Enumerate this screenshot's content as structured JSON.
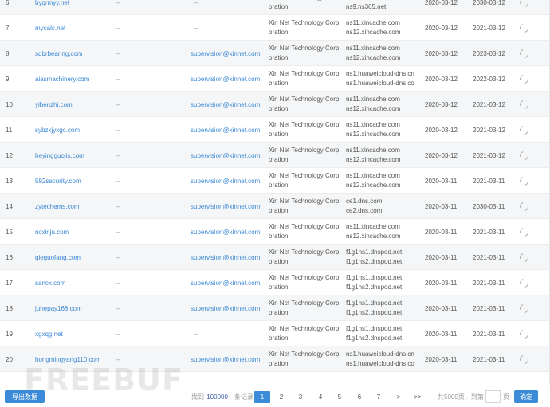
{
  "colors": {
    "accent": "#3b8bd8",
    "link": "#3a88d6",
    "row_stripe": "#f5f6f7"
  },
  "rows": [
    {
      "idx": "6",
      "domain": "byqrmyy.net",
      "d1": "--",
      "email": "--",
      "reg1": "Xin Net Technology Corp",
      "reg2": "oration",
      "ns1": "ns10.ns365.net",
      "ns2": "ns9.ns365.net",
      "date1": "2020-03-12",
      "date2": "2030-03-12"
    },
    {
      "idx": "7",
      "domain": "mycalc.net",
      "d1": "--",
      "email": "--",
      "reg1": "Xin Net Technology Corp",
      "reg2": "oration",
      "ns1": "ns11.xincache.com",
      "ns2": "ns12.xincache.com",
      "date1": "2020-03-12",
      "date2": "2021-03-12"
    },
    {
      "idx": "8",
      "domain": "sdbrbearing.com",
      "d1": "--",
      "email": "supervision@xinnet.com",
      "reg1": "Xin Net Technology Corp",
      "reg2": "oration",
      "ns1": "ns11.xincache.com",
      "ns2": "ns12.xincache.com",
      "date1": "2020-03-12",
      "date2": "2023-03-12"
    },
    {
      "idx": "9",
      "domain": "aiasmachinery.com",
      "d1": "--",
      "email": "supervision@xinnet.com",
      "reg1": "Xin Net Technology Corp",
      "reg2": "oration",
      "ns1": "ns1.huaweicloud-dns.cn",
      "ns2": "ns1.huaweicloud-dns.co",
      "date1": "2020-03-12",
      "date2": "2022-03-12"
    },
    {
      "idx": "10",
      "domain": "yibenzhi.com",
      "d1": "--",
      "email": "supervision@xinnet.com",
      "reg1": "Xin Net Technology Corp",
      "reg2": "oration",
      "ns1": "ns11.xincache.com",
      "ns2": "ns12.xincache.com",
      "date1": "2020-03-12",
      "date2": "2021-03-12"
    },
    {
      "idx": "11",
      "domain": "sybzkjyxgc.com",
      "d1": "--",
      "email": "supervision@xinnet.com",
      "reg1": "Xin Net Technology Corp",
      "reg2": "oration",
      "ns1": "ns11.xincache.com",
      "ns2": "ns12.xincache.com",
      "date1": "2020-03-12",
      "date2": "2021-03-12"
    },
    {
      "idx": "12",
      "domain": "heyingguojis.com",
      "d1": "--",
      "email": "supervision@xinnet.com",
      "reg1": "Xin Net Technology Corp",
      "reg2": "oration",
      "ns1": "ns11.xincache.com",
      "ns2": "ns12.xincache.com",
      "date1": "2020-03-12",
      "date2": "2021-03-12"
    },
    {
      "idx": "13",
      "domain": "592security.com",
      "d1": "--",
      "email": "supervision@xinnet.com",
      "reg1": "Xin Net Technology Corp",
      "reg2": "oration",
      "ns1": "ns11.xincache.com",
      "ns2": "ns12.xincache.com",
      "date1": "2020-03-11",
      "date2": "2021-03-11"
    },
    {
      "idx": "14",
      "domain": "zytechems.com",
      "d1": "--",
      "email": "supervision@xinnet.com",
      "reg1": "Xin Net Technology Corp",
      "reg2": "oration",
      "ns1": "ce1.dns.com",
      "ns2": "ce2.dns.com",
      "date1": "2020-03-11",
      "date2": "2030-03-11"
    },
    {
      "idx": "15",
      "domain": "ncxinju.com",
      "d1": "--",
      "email": "supervision@xinnet.com",
      "reg1": "Xin Net Technology Corp",
      "reg2": "oration",
      "ns1": "ns11.xincache.com",
      "ns2": "ns12.xincache.com",
      "date1": "2020-03-11",
      "date2": "2021-03-11"
    },
    {
      "idx": "16",
      "domain": "qieguofang.com",
      "d1": "--",
      "email": "supervision@xinnet.com",
      "reg1": "Xin Net Technology Corp",
      "reg2": "oration",
      "ns1": "f1g1ns1.dnspod.net",
      "ns2": "f1g1ns2.dnspod.net",
      "date1": "2020-03-11",
      "date2": "2021-03-11"
    },
    {
      "idx": "17",
      "domain": "sancx.com",
      "d1": "--",
      "email": "supervision@xinnet.com",
      "reg1": "Xin Net Technology Corp",
      "reg2": "oration",
      "ns1": "f1g1ns1.dnspod.net",
      "ns2": "f1g1ns2.dnspod.net",
      "date1": "2020-03-11",
      "date2": "2021-03-11"
    },
    {
      "idx": "18",
      "domain": "juhepay168.com",
      "d1": "--",
      "email": "supervision@xinnet.com",
      "reg1": "Xin Net Technology Corp",
      "reg2": "oration",
      "ns1": "f1g1ns1.dnspod.net",
      "ns2": "f1g1ns2.dnspod.net",
      "date1": "2020-03-11",
      "date2": "2021-03-11"
    },
    {
      "idx": "19",
      "domain": "xgxqg.net",
      "d1": "--",
      "email": "--",
      "reg1": "Xin Net Technology Corp",
      "reg2": "oration",
      "ns1": "f1g1ns1.dnspod.net",
      "ns2": "f1g1ns2.dnspod.net",
      "date1": "2020-03-11",
      "date2": "2021-03-11"
    },
    {
      "idx": "20",
      "domain": "hongmingyang110.com",
      "d1": "--",
      "email": "supervision@xinnet.com",
      "reg1": "Xin Net Technology Corp",
      "reg2": "oration",
      "ns1": "ns1.huaweicloud-dns.cn",
      "ns2": "ns1.huaweicloud-dns.co",
      "date1": "2020-03-11",
      "date2": "2021-03-11"
    }
  ],
  "footer": {
    "export_label": "导出数据",
    "total_prefix": "找到",
    "total_count": "100000+",
    "total_suffix": "条记录",
    "pages": [
      "1",
      "2",
      "3",
      "4",
      "5",
      "6",
      "7",
      ">",
      ">>"
    ],
    "active_page": "1",
    "page_info": "共5000页，到第",
    "page_input_value": "",
    "page_suffix": "页",
    "confirm_label": "确定"
  },
  "watermark": "FREEBUF"
}
